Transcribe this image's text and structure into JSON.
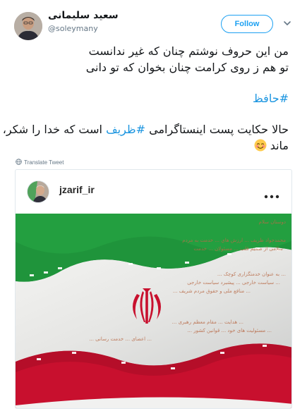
{
  "author": {
    "display_name": "سعید سلیمانی",
    "handle": "@soleymany"
  },
  "actions": {
    "follow_label": "Follow"
  },
  "tweet": {
    "line1": "من این حروف نوشتم چنان که غیر ندانست",
    "line2": "تو هم ز روی کرامت چنان بخوان که تو دانی",
    "hashtag1": "#حافظ",
    "line3_before": "حالا حکایت پست اینستاگرامی ",
    "hashtag2": "#ظریف",
    "line3_after": " است که خدا را شکر،",
    "line4": "ماند",
    "emoji_icon": "smiling-face-emoji-icon"
  },
  "translate_label": "Translate Tweet",
  "instagram": {
    "username": "jzarif_ir",
    "overlay_lines": [
      "دوستان سلام",
      "محمدجواد ظریف ... ارزش هاي ... خدمت به مردم",
      "سلامی از صمیم قلب ... مسئولان ... خدمت",
      "... به عنوان خدمتگزاری کوچک ...",
      "... سیاست خارجی ... پیشبرد سیاست خارجی",
      "... منافع ملی و حقوق مردم شریف ...",
      "... هدایت ... مقام معظم رهبری ...",
      "... مسئولیت های خود ... قوانین کشور ...",
      "... اعضای ... خدمت رسانی ..."
    ]
  },
  "colors": {
    "accent": "#1da1f2",
    "hashtag": "#1b95e0",
    "flag_green": "#239f40",
    "flag_red": "#c8102e"
  }
}
